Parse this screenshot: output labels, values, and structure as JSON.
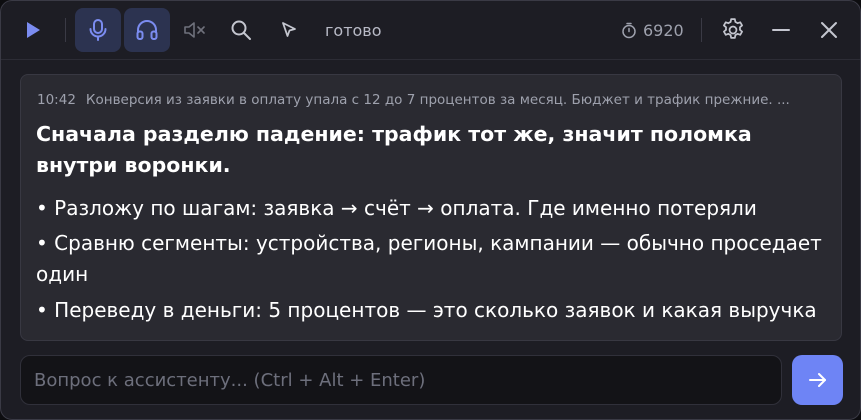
{
  "toolbar": {
    "status": "готово",
    "counter": "6920"
  },
  "message": {
    "time": "10:42",
    "question": "Конверсия из заявки в оплату упала с 12 до 7 процентов за месяц. Бюджет и трафик прежние. ...",
    "title": "Сначала разделю падение: трафик тот же, значит поломка внутри воронки.",
    "bullets": [
      "• Разложу по шагам: заявка → счёт → оплата. Где именно потеряли",
      "• Сравню сегменты: устройства, регионы, кампании — обычно проседает один",
      "• Переведу в деньги: 5 процентов — это сколько заявок и какая выручка"
    ]
  },
  "input": {
    "placeholder": "Вопрос к ассистенту... (Ctrl + Alt + Enter)",
    "value": ""
  },
  "colors": {
    "accent": "#6e84f5",
    "icon_active": "#7b8cf0",
    "icon_muted": "#8b8d99",
    "background": "#1d1d24",
    "card": "#2a2a31"
  },
  "icons": {
    "play": "play-icon",
    "mic": "microphone-icon",
    "headphones": "headphones-icon",
    "speaker_muted": "speaker-muted-icon",
    "search": "search-icon",
    "cursor": "cursor-icon",
    "timer": "timer-icon",
    "settings": "gear-icon",
    "minimize": "minimize-icon",
    "close": "close-icon",
    "send": "arrow-right-icon"
  }
}
